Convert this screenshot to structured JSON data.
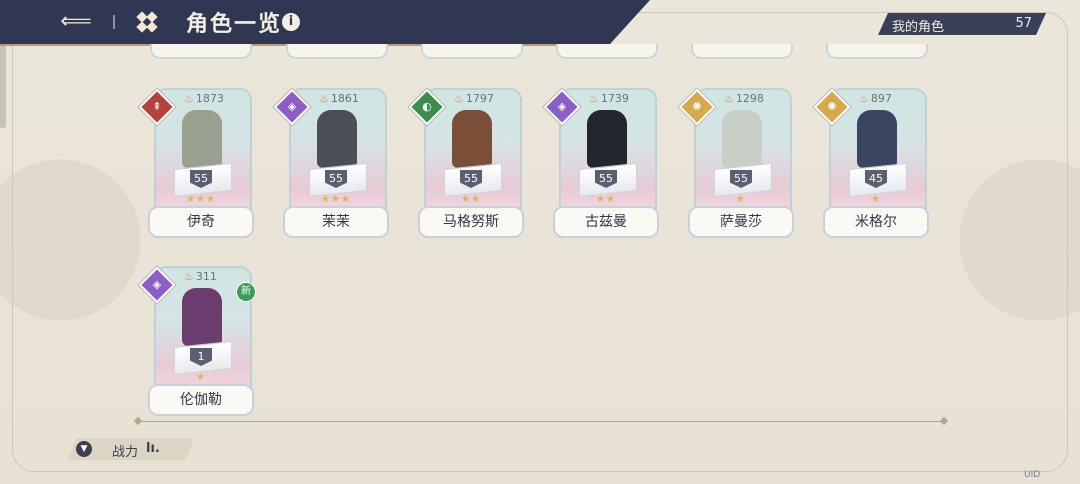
{
  "header": {
    "title": "角色一览",
    "back_icon": "back-arrow-icon",
    "grid_icon": "grid-icon",
    "info_icon": "info-icon"
  },
  "my_characters": {
    "label": "我的角色",
    "count": "57"
  },
  "characters": [
    {
      "name": "伊奇",
      "power": "1873",
      "level": "55",
      "stars": "★★★",
      "element_color": "#b4423a",
      "element_glyph": "⇞",
      "sprite_color": "#9aa08f"
    },
    {
      "name": "茉茉",
      "power": "1861",
      "level": "55",
      "stars": "★★★",
      "element_color": "#8b5fc7",
      "element_glyph": "◈",
      "sprite_color": "#4b4e58"
    },
    {
      "name": "马格努斯",
      "power": "1797",
      "level": "55",
      "stars": "★★",
      "element_color": "#3c8c4e",
      "element_glyph": "◐",
      "sprite_color": "#7a4e37"
    },
    {
      "name": "古兹曼",
      "power": "1739",
      "level": "55",
      "stars": "★★",
      "element_color": "#8b5fc7",
      "element_glyph": "◈",
      "sprite_color": "#24262d"
    },
    {
      "name": "萨曼莎",
      "power": "1298",
      "level": "55",
      "stars": "★",
      "element_color": "#d6a94b",
      "element_glyph": "✺",
      "sprite_color": "#c7cfc6"
    },
    {
      "name": "米格尔",
      "power": "897",
      "level": "45",
      "stars": "★",
      "element_color": "#d6a94b",
      "element_glyph": "✺",
      "sprite_color": "#3a4560"
    },
    {
      "name": "伦伽勒",
      "power": "311",
      "level": "1",
      "stars": "★",
      "element_color": "#8b5fc7",
      "element_glyph": "◈",
      "sprite_color": "#6a3d6e",
      "badge": "新"
    }
  ],
  "sort": {
    "label": "战力",
    "bars": "lı."
  },
  "uid_label": "UID"
}
